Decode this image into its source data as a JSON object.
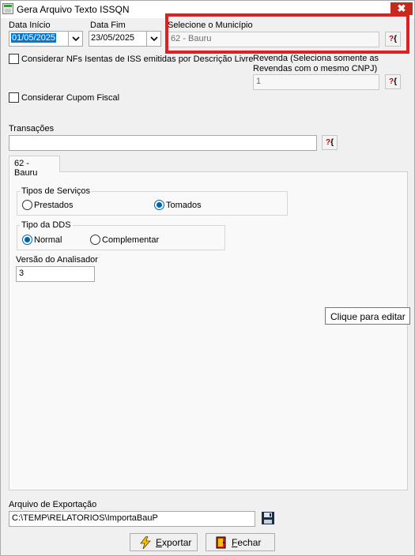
{
  "window": {
    "title": "Gera Arquivo Texto ISSQN",
    "close_glyph": "✖"
  },
  "filters": {
    "data_inicio_label": "Data Início",
    "data_inicio_value": "01/05/2025",
    "data_fim_label": "Data Fim",
    "data_fim_value": "23/05/2025",
    "municipio_label": "Selecione o Município",
    "municipio_value": "62 - Bauru",
    "revenda_label_line1": "Revenda (Seleciona somente as",
    "revenda_label_line2": "Revendas com o mesmo CNPJ)",
    "revenda_value": "1",
    "nfs_isentas_label": "Considerar NFs Isentas de ISS emitidas por Descrição Livre",
    "cupom_fiscal_label": "Considerar Cupom Fiscal",
    "transacoes_label": "Transações",
    "transacoes_value": "",
    "lookup_q": "?",
    "lookup_b": "{"
  },
  "tab": {
    "label": "62 - Bauru",
    "tipos_servicos": {
      "title": "Tipos de Serviços",
      "options": [
        "Prestados",
        "Tomados"
      ],
      "selected": "Tomados"
    },
    "tipo_dds": {
      "title": "Tipo da DDS",
      "options": [
        "Normal",
        "Complementar"
      ],
      "selected": "Normal"
    },
    "versao_label": "Versão do Analisador",
    "versao_value": "3",
    "tooltip": "Clique para editar"
  },
  "export": {
    "label": "Arquivo de Exportação",
    "path": "C:\\TEMP\\RELATORIOS\\ImportaBauP"
  },
  "buttons": {
    "exportar_underline": "E",
    "exportar_rest": "xportar",
    "fechar_underline": "F",
    "fechar_rest": "echar"
  },
  "icons": {
    "app": "app-window-icon",
    "dropdown": "chevron-down-icon",
    "lookup": "lookup-search-icon",
    "save": "floppy-disk-icon",
    "exportar": "lightning-icon",
    "fechar": "exit-door-icon"
  },
  "colors": {
    "highlight": "#e02020",
    "selection": "#0078d7",
    "radio_checked": "#0063b1",
    "close": "#c42b1c"
  }
}
